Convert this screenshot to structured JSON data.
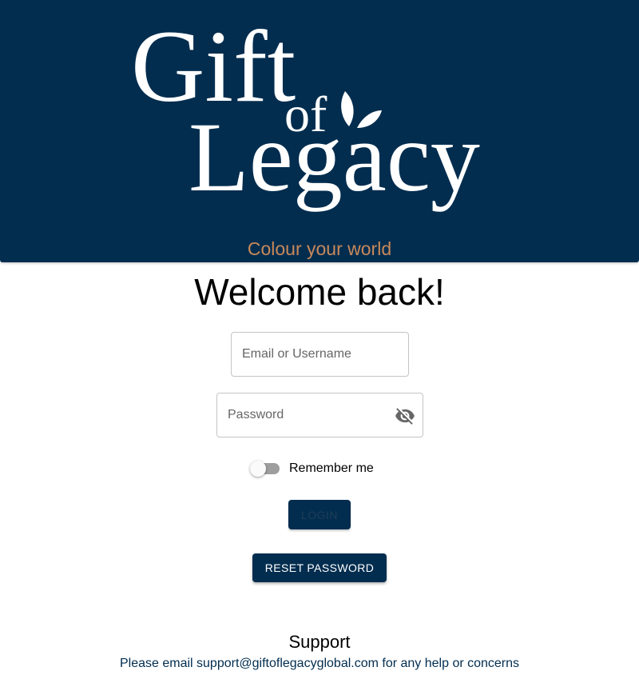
{
  "banner": {
    "logo_line1": "Gift",
    "logo_line2": "of",
    "logo_line3": "Legacy",
    "tagline": "Colour your world"
  },
  "login": {
    "title": "Welcome back!",
    "email_placeholder": "Email or Username",
    "email_value": "",
    "password_placeholder": "Password",
    "password_value": "",
    "remember_label": "Remember me",
    "remember_on": false,
    "login_label": "LOGIN",
    "reset_label": "RESET PASSWORD"
  },
  "support": {
    "title": "Support",
    "text_before": "Please email ",
    "email": "support@giftoflegacyglobal.com",
    "text_after": " for any help or concerns"
  },
  "icons": {
    "password_toggle": "eye-off-icon",
    "logo_mark": "leaf-icon"
  },
  "colors": {
    "brand_navy": "#022d4f",
    "tagline_orange": "#c8895a"
  }
}
